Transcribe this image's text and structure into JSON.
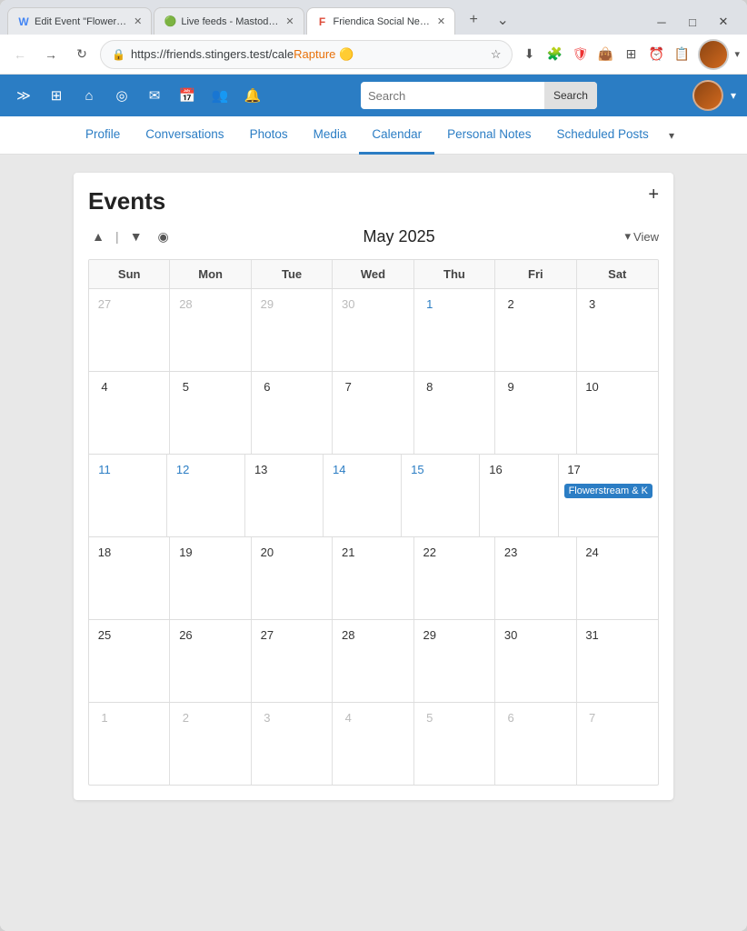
{
  "browser": {
    "tabs": [
      {
        "id": "tab1",
        "icon": "W",
        "title": "Edit Event \"Flower…",
        "active": false,
        "color": "#4285f4"
      },
      {
        "id": "tab2",
        "icon": "🟢",
        "title": "Live feeds - Mastod…",
        "active": false,
        "color": "#6364ff"
      },
      {
        "id": "tab3",
        "icon": "F",
        "title": "Friendica Social Ne…",
        "active": true,
        "color": "#dd4b39"
      }
    ],
    "nav": {
      "url_prefix": "https://friends.stingers.test/cale",
      "url_highlight": "Rapture 🟡",
      "url_rest": ""
    }
  },
  "app_header": {
    "icons": [
      "≫",
      "⊞",
      "⌂",
      "◎",
      "✉",
      "📅",
      "👥",
      "🔔"
    ],
    "search_placeholder": "Search",
    "search_btn_label": "Search"
  },
  "sub_nav": {
    "items": [
      {
        "id": "profile",
        "label": "Profile",
        "active": false
      },
      {
        "id": "conversations",
        "label": "Conversations",
        "active": false
      },
      {
        "id": "photos",
        "label": "Photos",
        "active": false
      },
      {
        "id": "media",
        "label": "Media",
        "active": false
      },
      {
        "id": "calendar",
        "label": "Calendar",
        "active": true
      },
      {
        "id": "personal-notes",
        "label": "Personal Notes",
        "active": false
      },
      {
        "id": "scheduled-posts",
        "label": "Scheduled Posts",
        "active": false
      }
    ]
  },
  "calendar": {
    "title": "Events",
    "month_year": "May 2025",
    "view_label": "View",
    "add_btn": "+",
    "days_header": [
      "Sun",
      "Mon",
      "Tue",
      "Wed",
      "Thu",
      "Fri",
      "Sat"
    ],
    "weeks": [
      {
        "cells": [
          {
            "date": "27",
            "other": true,
            "highlighted": false
          },
          {
            "date": "28",
            "other": true,
            "highlighted": false
          },
          {
            "date": "29",
            "other": true,
            "highlighted": false
          },
          {
            "date": "30",
            "other": true,
            "highlighted": false
          },
          {
            "date": "1",
            "other": false,
            "highlighted": true
          },
          {
            "date": "2",
            "other": false,
            "highlighted": false
          },
          {
            "date": "3",
            "other": false,
            "highlighted": false
          }
        ]
      },
      {
        "cells": [
          {
            "date": "4",
            "other": false,
            "highlighted": false
          },
          {
            "date": "5",
            "other": false,
            "highlighted": false
          },
          {
            "date": "6",
            "other": false,
            "highlighted": false
          },
          {
            "date": "7",
            "other": false,
            "highlighted": false
          },
          {
            "date": "8",
            "other": false,
            "highlighted": false
          },
          {
            "date": "9",
            "other": false,
            "highlighted": false
          },
          {
            "date": "10",
            "other": false,
            "highlighted": false
          }
        ]
      },
      {
        "cells": [
          {
            "date": "11",
            "other": false,
            "highlighted": true
          },
          {
            "date": "12",
            "other": false,
            "highlighted": true
          },
          {
            "date": "13",
            "other": false,
            "highlighted": false
          },
          {
            "date": "14",
            "other": false,
            "highlighted": true
          },
          {
            "date": "15",
            "other": false,
            "highlighted": true
          },
          {
            "date": "16",
            "other": false,
            "highlighted": false
          },
          {
            "date": "17",
            "other": false,
            "highlighted": false,
            "event": "Flowerstream & K"
          }
        ]
      },
      {
        "cells": [
          {
            "date": "18",
            "other": false,
            "highlighted": false
          },
          {
            "date": "19",
            "other": false,
            "highlighted": false
          },
          {
            "date": "20",
            "other": false,
            "highlighted": false
          },
          {
            "date": "21",
            "other": false,
            "highlighted": false
          },
          {
            "date": "22",
            "other": false,
            "highlighted": false
          },
          {
            "date": "23",
            "other": false,
            "highlighted": false
          },
          {
            "date": "24",
            "other": false,
            "highlighted": false
          }
        ]
      },
      {
        "cells": [
          {
            "date": "25",
            "other": false,
            "highlighted": false
          },
          {
            "date": "26",
            "other": false,
            "highlighted": false
          },
          {
            "date": "27",
            "other": false,
            "highlighted": false
          },
          {
            "date": "28",
            "other": false,
            "highlighted": false
          },
          {
            "date": "29",
            "other": false,
            "highlighted": false
          },
          {
            "date": "30",
            "other": false,
            "highlighted": false
          },
          {
            "date": "31",
            "other": false,
            "highlighted": false
          }
        ]
      },
      {
        "cells": [
          {
            "date": "1",
            "other": true,
            "highlighted": false
          },
          {
            "date": "2",
            "other": true,
            "highlighted": false
          },
          {
            "date": "3",
            "other": true,
            "highlighted": false
          },
          {
            "date": "4",
            "other": true,
            "highlighted": false
          },
          {
            "date": "5",
            "other": true,
            "highlighted": false
          },
          {
            "date": "6",
            "other": true,
            "highlighted": false
          },
          {
            "date": "7",
            "other": true,
            "highlighted": false
          }
        ]
      }
    ]
  }
}
